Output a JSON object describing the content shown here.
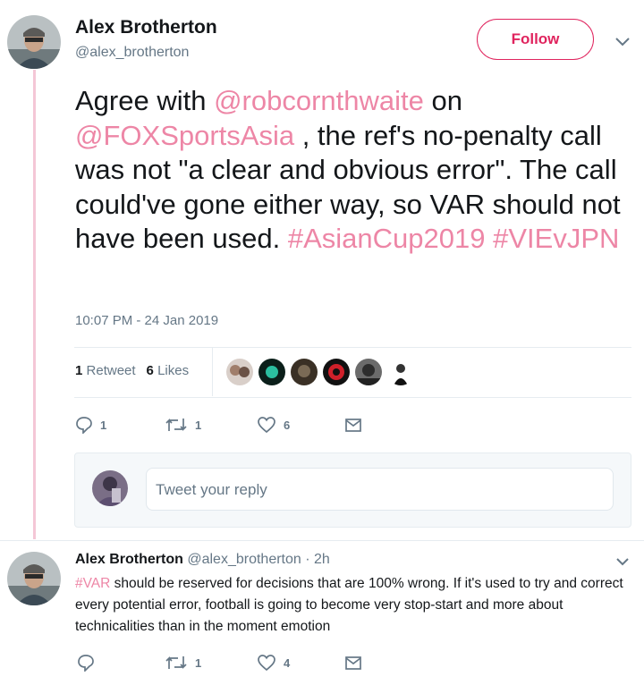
{
  "tweet": {
    "author_name": "Alex Brotherton",
    "author_handle": "@alex_brotherton",
    "follow_label": "Follow",
    "text_parts": {
      "p1": "Agree with ",
      "m1": "@robcornthwaite",
      "p2": " on ",
      "m2": "@FOXSportsAsia",
      "p3": " , the ref's no-penalty call was not \"a clear and obvious error\". The call could've gone either way, so VAR should not have been used. ",
      "h1": "#AsianCup2019",
      "p4": " ",
      "h2": "#VIEvJPN"
    },
    "timestamp": "10:07 PM - 24 Jan 2019",
    "retweet_count": "1",
    "retweet_label": "Retweet",
    "like_count": "6",
    "like_label": "Likes",
    "actions": {
      "reply_count": "1",
      "retweet_count": "1",
      "like_count": "6"
    }
  },
  "reply_box": {
    "placeholder": "Tweet your reply"
  },
  "reply_tweet": {
    "author_name": "Alex Brotherton",
    "author_handle": "@alex_brotherton",
    "time": "· 2h",
    "hashtag": "#VAR",
    "text": " should be reserved for decisions that are 100% wrong. If it's used to try and correct every potential error, football is going to become very stop-start and more about technicalities than in the moment emotion",
    "actions": {
      "reply_count": "",
      "retweet_count": "1",
      "like_count": "4"
    }
  },
  "colors": {
    "accent": "#e0245e",
    "muted": "#657786",
    "thread_line": "#f4c7d6"
  }
}
